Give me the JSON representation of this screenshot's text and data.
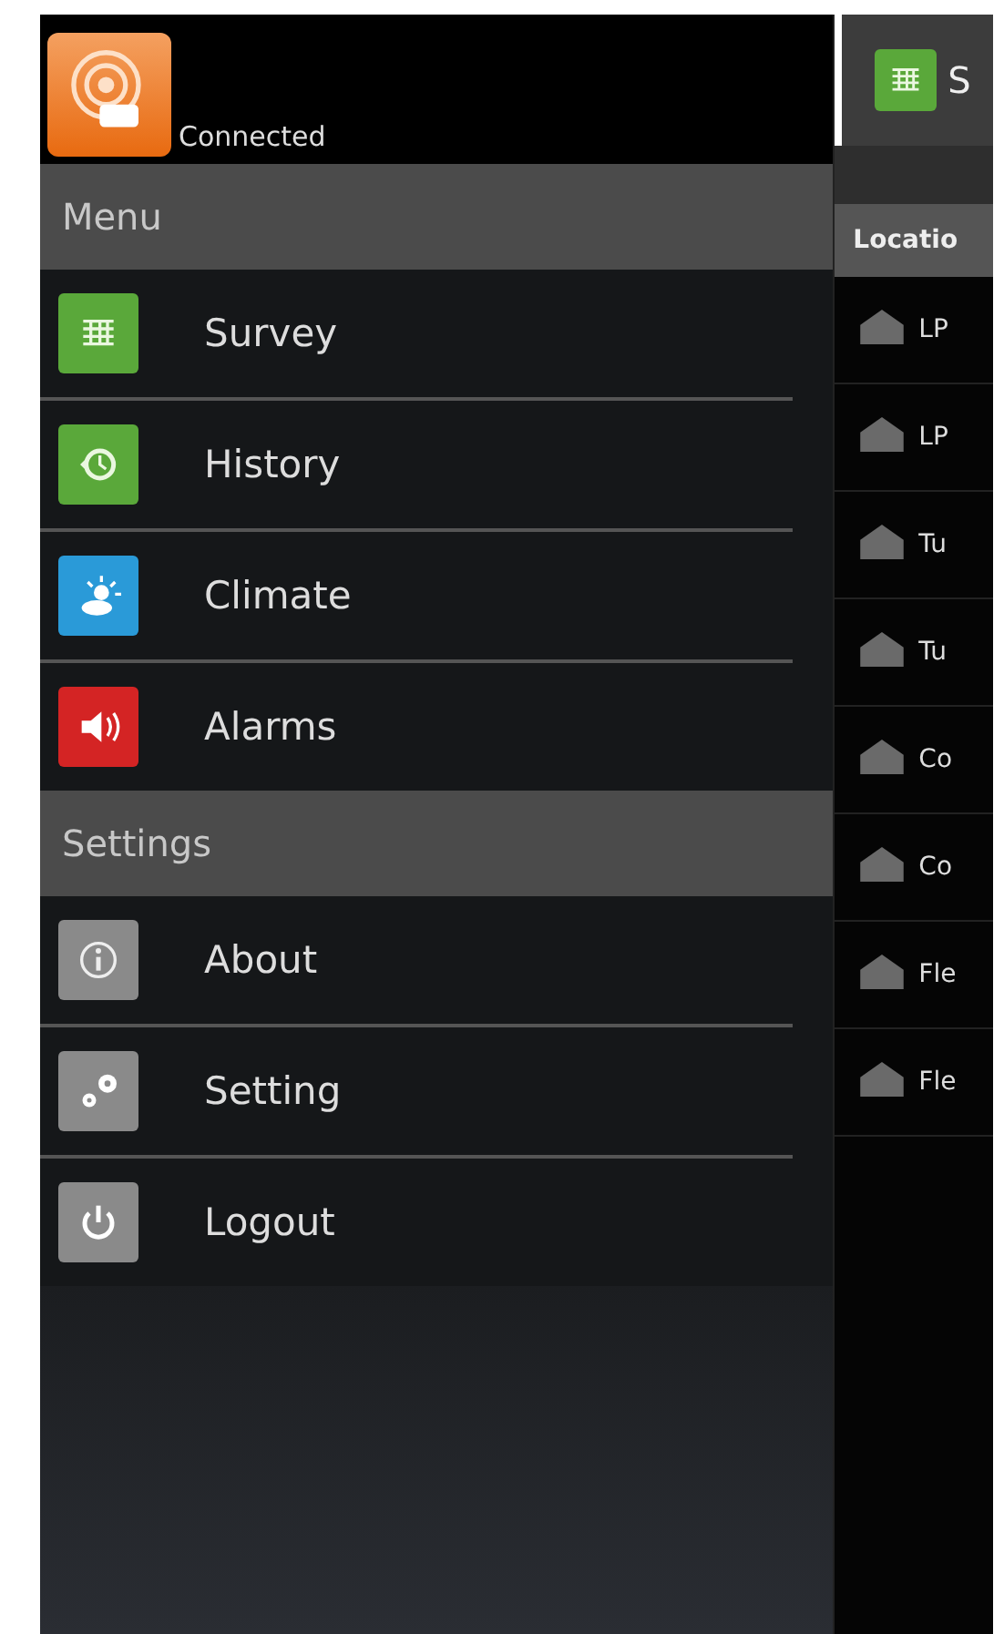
{
  "status": {
    "label": "Connected"
  },
  "sections": [
    {
      "title": "Menu",
      "items": [
        {
          "label": "Survey",
          "kind": "survey"
        },
        {
          "label": "History",
          "kind": "history"
        },
        {
          "label": "Climate",
          "kind": "climate"
        },
        {
          "label": "Alarms",
          "kind": "alarms"
        }
      ]
    },
    {
      "title": "Settings",
      "items": [
        {
          "label": "About",
          "kind": "about"
        },
        {
          "label": "Setting",
          "kind": "setting"
        },
        {
          "label": "Logout",
          "kind": "logout"
        }
      ]
    }
  ],
  "content": {
    "title": "S",
    "column": "Locatio",
    "rows": [
      "LP",
      "LP",
      "Tu",
      "Tu",
      "Co",
      "Co",
      "Fle",
      "Fle"
    ]
  }
}
